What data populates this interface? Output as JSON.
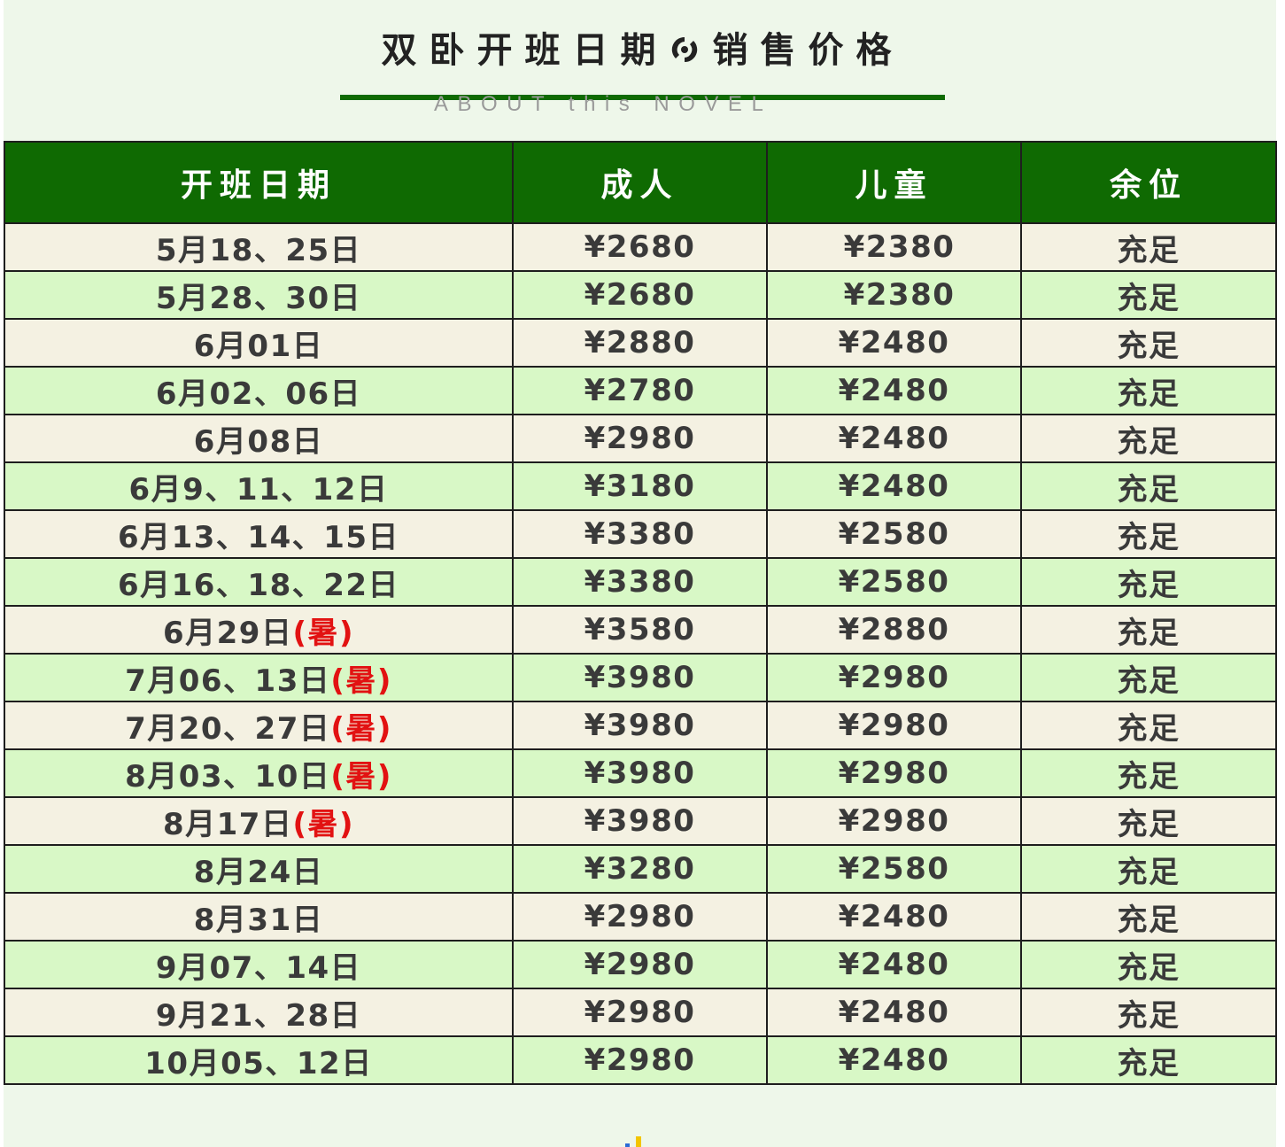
{
  "header": {
    "title_left": "双卧开班日期",
    "title_right": "销售价格",
    "subtitle": "ABOUT this NOVEL",
    "divider_icon": "swirl-icon"
  },
  "table": {
    "columns": [
      "开班日期",
      "成人",
      "儿童",
      "余位"
    ],
    "rows": [
      {
        "date": "5月18、25日",
        "tag": "",
        "adult": "¥2680",
        "child": "¥2380",
        "seats": "充足"
      },
      {
        "date": "5月28、30日",
        "tag": "",
        "adult": "¥2680",
        "child": "¥2380",
        "seats": "充足"
      },
      {
        "date": "6月01日",
        "tag": "",
        "adult": "¥2880",
        "child": "¥2480",
        "seats": "充足"
      },
      {
        "date": "6月02、06日",
        "tag": "",
        "adult": "¥2780",
        "child": "¥2480",
        "seats": "充足"
      },
      {
        "date": "6月08日",
        "tag": "",
        "adult": "¥2980",
        "child": "¥2480",
        "seats": "充足"
      },
      {
        "date": "6月9、11、12日",
        "tag": "",
        "adult": "¥3180",
        "child": "¥2480",
        "seats": "充足"
      },
      {
        "date": "6月13、14、15日",
        "tag": "",
        "adult": "¥3380",
        "child": "¥2580",
        "seats": "充足"
      },
      {
        "date": "6月16、18、22日",
        "tag": "",
        "adult": "¥3380",
        "child": "¥2580",
        "seats": "充足"
      },
      {
        "date": "6月29日",
        "tag": "(暑)",
        "adult": "¥3580",
        "child": "¥2880",
        "seats": "充足"
      },
      {
        "date": "7月06、13日",
        "tag": "(暑)",
        "adult": "¥3980",
        "child": "¥2980",
        "seats": "充足"
      },
      {
        "date": "7月20、27日",
        "tag": "(暑)",
        "adult": "¥3980",
        "child": "¥2980",
        "seats": "充足"
      },
      {
        "date": "8月03、10日",
        "tag": "(暑)",
        "adult": "¥3980",
        "child": "¥2980",
        "seats": "充足"
      },
      {
        "date": "8月17日",
        "tag": "(暑)",
        "adult": "¥3980",
        "child": "¥2980",
        "seats": "充足"
      },
      {
        "date": "8月24日",
        "tag": "",
        "adult": "¥3280",
        "child": "¥2580",
        "seats": "充足"
      },
      {
        "date": "8月31日",
        "tag": "",
        "adult": "¥2980",
        "child": "¥2480",
        "seats": "充足"
      },
      {
        "date": "9月07、14日",
        "tag": "",
        "adult": "¥2980",
        "child": "¥2480",
        "seats": "充足"
      },
      {
        "date": "9月21、28日",
        "tag": "",
        "adult": "¥2980",
        "child": "¥2480",
        "seats": "充足"
      },
      {
        "date": "10月05、12日",
        "tag": "",
        "adult": "¥2980",
        "child": "¥2480",
        "seats": "充足"
      }
    ]
  },
  "colors": {
    "header_green": "#0f6a02",
    "row_odd": "#f4f1e2",
    "row_even": "#d8f8c6",
    "summer_tag": "#e21212",
    "page_bg": "#eef7ea"
  }
}
